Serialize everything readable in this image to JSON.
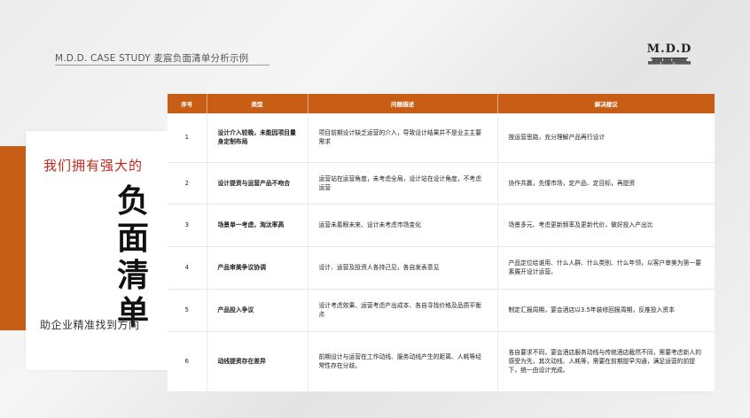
{
  "header": {
    "title": "M.D.D. CASE STUDY 麦宸负面清单分析示例"
  },
  "logo": {
    "text": "M.D.D",
    "subtitle_lines": [
      "█████ ████ ███████",
      "██████ ██████ ████████"
    ]
  },
  "left_panel": {
    "top_line": "我们拥有强大的",
    "big_chars": [
      "负",
      "面",
      "清",
      "单"
    ],
    "bottom_line": "助企业精准找到方向"
  },
  "colors": {
    "accent": "#c85e16",
    "headline_red": "#c0271d"
  },
  "table": {
    "headers": [
      "序号",
      "类型",
      "问题描述",
      "解决建议"
    ],
    "rows": [
      {
        "no": "1",
        "type": "设计介入较晚，未能因项目量身定制布局",
        "desc": "项目前期设计缺乏运营的介入，导致设计结果并不是业主主要需求",
        "sol": "按运营思路，充分理解产品再行设计"
      },
      {
        "no": "2",
        "type": "设计提资与运营产品不吻合",
        "desc": "运营站在运营角度，未考虑全局，设计站在设计角度，不考虑运营",
        "sol": "协作共赢，先懂市场，定产品、定目标，再提资"
      },
      {
        "no": "3",
        "type": "场景单一考虑，淘汰率高",
        "desc": "运营未着眼未来、设计未考虑市场变化",
        "sol": "场景多元、考虑更新频率及更新代价，做好投入产出比"
      },
      {
        "no": "4",
        "type": "产品审美争议协调",
        "desc": "设计、运营及投资人各持己见，各自发表意见",
        "sol": "产品定位给谁用、什么人群、什么类别、什么年领，以客户审美为第一要素展开设计运营。"
      },
      {
        "no": "5",
        "type": "产品投入争议",
        "desc": "设计考虑效果、运营考虑产出成本、各自寻找价格及品质平衡点",
        "sol": "制定汇报周期，宴会酒店以3.5年装修回报周期，反推投入资本"
      },
      {
        "no": "6",
        "type": "动线提资存在差异",
        "desc": "前期设计与运营在工作动线、服务动线产生的距离、人耗等经常性存在分歧。",
        "sol": "各自要求不同，宴会酒店服务动线与传统酒店截然不同，需要考虑新人的感受为先，其次动线、人耗等，需要在前期提早沟通，满足运营的前提下，统一由设计完成。"
      }
    ]
  }
}
